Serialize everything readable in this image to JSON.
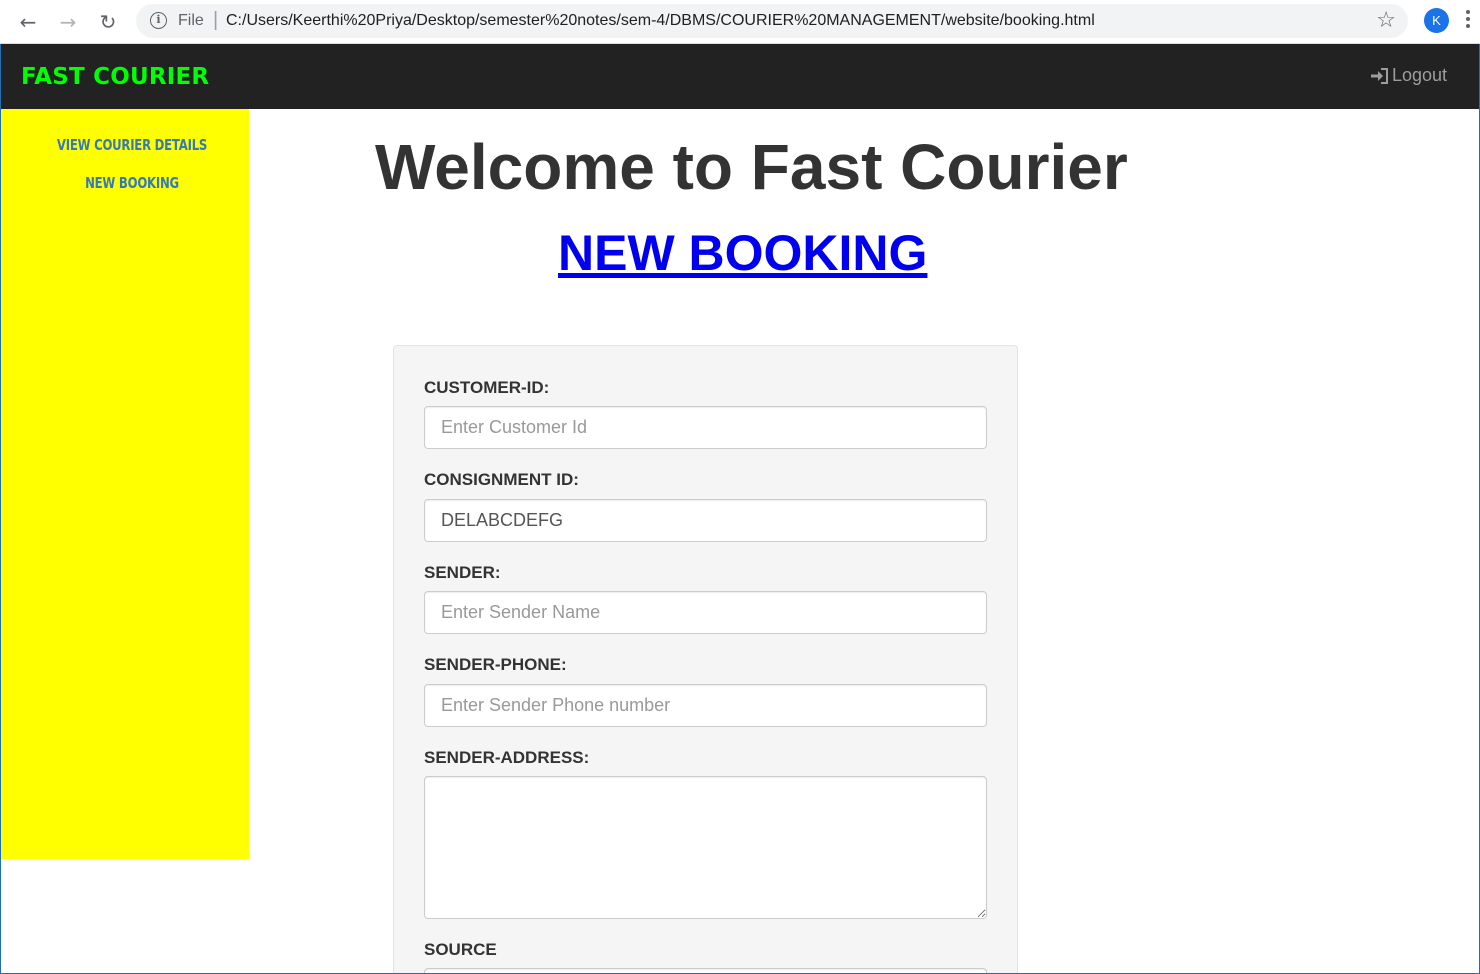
{
  "browser": {
    "file_label": "File",
    "url": "C:/Users/Keerthi%20Priya/Desktop/semester%20notes/sem-4/DBMS/COURIER%20MANAGEMENT/website/booking.html",
    "profile_initial": "K",
    "icons": [
      "back-arrow-icon",
      "forward-arrow-icon",
      "reload-icon",
      "info-icon",
      "star-icon",
      "menu-icon"
    ]
  },
  "navbar": {
    "brand": "FAST COURIER",
    "brand_color": "#00ff00",
    "logout_label": "Logout"
  },
  "sidebar": {
    "background": "#ffff00",
    "items": [
      {
        "label": "VIEW COURIER DETAILS"
      },
      {
        "label": "NEW BOOKING"
      }
    ]
  },
  "main": {
    "welcome": "Welcome to Fast Courier",
    "booking_link": "NEW BOOKING"
  },
  "form": {
    "fields": [
      {
        "label": "CUSTOMER-ID:",
        "placeholder": "Enter Customer Id",
        "value": ""
      },
      {
        "label": "CONSIGNMENT ID:",
        "placeholder": "",
        "value": "DELABCDEFG"
      },
      {
        "label": "SENDER:",
        "placeholder": "Enter Sender Name",
        "value": ""
      },
      {
        "label": "SENDER-PHONE:",
        "placeholder": "Enter Sender Phone number",
        "value": ""
      },
      {
        "label": "SENDER-ADDRESS:",
        "placeholder": "",
        "value": ""
      },
      {
        "label": "SOURCE",
        "placeholder": "",
        "value": ""
      }
    ]
  }
}
